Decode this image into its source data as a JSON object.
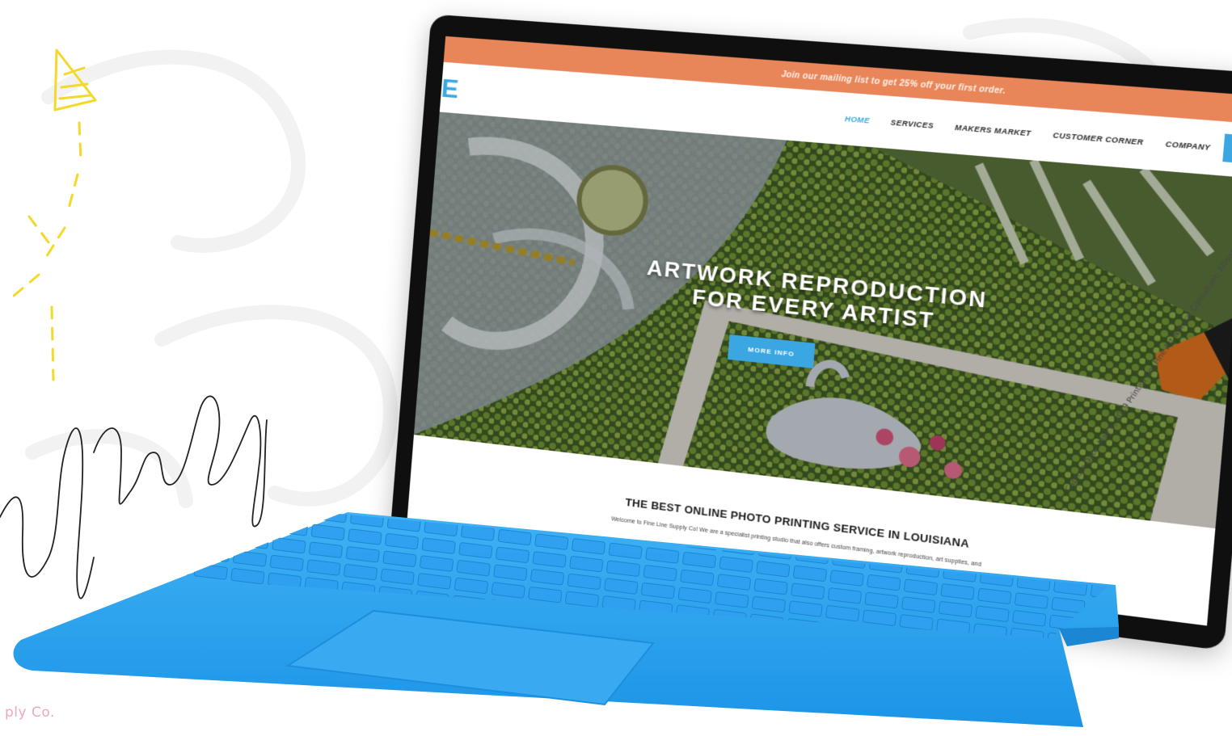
{
  "page": {
    "caption": "ply Co.",
    "signature_text": "ry McCoy"
  },
  "website": {
    "promo_banner": "Join our mailing list to get 25% off your first order.",
    "logo_fragment": "E",
    "nav": {
      "items": [
        {
          "label": "HOME",
          "active": true
        },
        {
          "label": "SERVICES",
          "active": false
        },
        {
          "label": "MAKERS MARKET",
          "active": false
        },
        {
          "label": "CUSTOMER CORNER",
          "active": false
        },
        {
          "label": "COMPANY",
          "active": false
        }
      ]
    },
    "hero": {
      "title_line1": "ARTWORK REPRODUCTION",
      "title_line2": "FOR EVERY ARTIST",
      "button_label": "MORE INFO",
      "print_caption": "Capture Date: May 6, 2019 Printed On: Fine Art Natural Consultant: Allison Elliott"
    },
    "section": {
      "title": "THE BEST ONLINE PHOTO PRINTING SERVICE IN LOUISIANA",
      "body": "Welcome to Fine Line Supply Co! We are a specialist printing studio that also offers custom framing, artwork reproduction, art supplies, and"
    }
  },
  "colors": {
    "promo_bar": "#e8865a",
    "accent_blue": "#3aa7e3",
    "keyboard_blue": "#2aa3ee",
    "doodle_yellow": "#f2d92a",
    "caption_pink": "#f2a6bd"
  }
}
